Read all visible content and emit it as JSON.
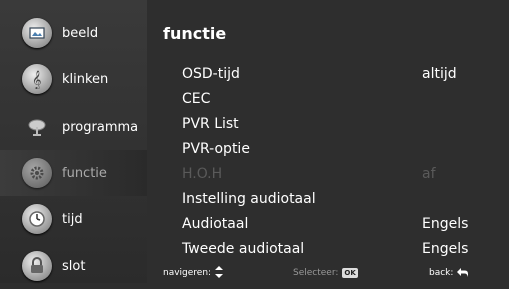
{
  "sidebar": {
    "items": [
      {
        "label": "beeld",
        "icon": "picture-icon"
      },
      {
        "label": "klinken",
        "icon": "music-note-icon"
      },
      {
        "label": "programma",
        "icon": "satellite-dish-icon"
      },
      {
        "label": "functie",
        "icon": "gear-icon"
      },
      {
        "label": "tijd",
        "icon": "clock-icon"
      },
      {
        "label": "slot",
        "icon": "lock-icon"
      }
    ],
    "active_index": 3
  },
  "main": {
    "title": "functie",
    "rows": [
      {
        "label": "OSD-tijd",
        "value": "altijd"
      },
      {
        "label": "CEC",
        "value": ""
      },
      {
        "label": "PVR List",
        "value": ""
      },
      {
        "label": "PVR-optie",
        "value": ""
      },
      {
        "label": "H.O.H",
        "value": "af",
        "disabled": true
      },
      {
        "label": "Instelling audiotaal",
        "value": ""
      },
      {
        "label": "Audiotaal",
        "value": "Engels"
      },
      {
        "label": "Tweede audiotaal",
        "value": "Engels"
      }
    ]
  },
  "footer": {
    "navigate_label": "navigeren:",
    "navigate_icon": "up-down-arrows-icon",
    "select_label": "Selecteer:",
    "select_key": "OK",
    "back_label": "back:",
    "back_icon": "return-arrow-icon"
  },
  "colors": {
    "background": "#2e2e2e",
    "sidebar": "#333333",
    "disabled_text": "#5a5a5a"
  }
}
